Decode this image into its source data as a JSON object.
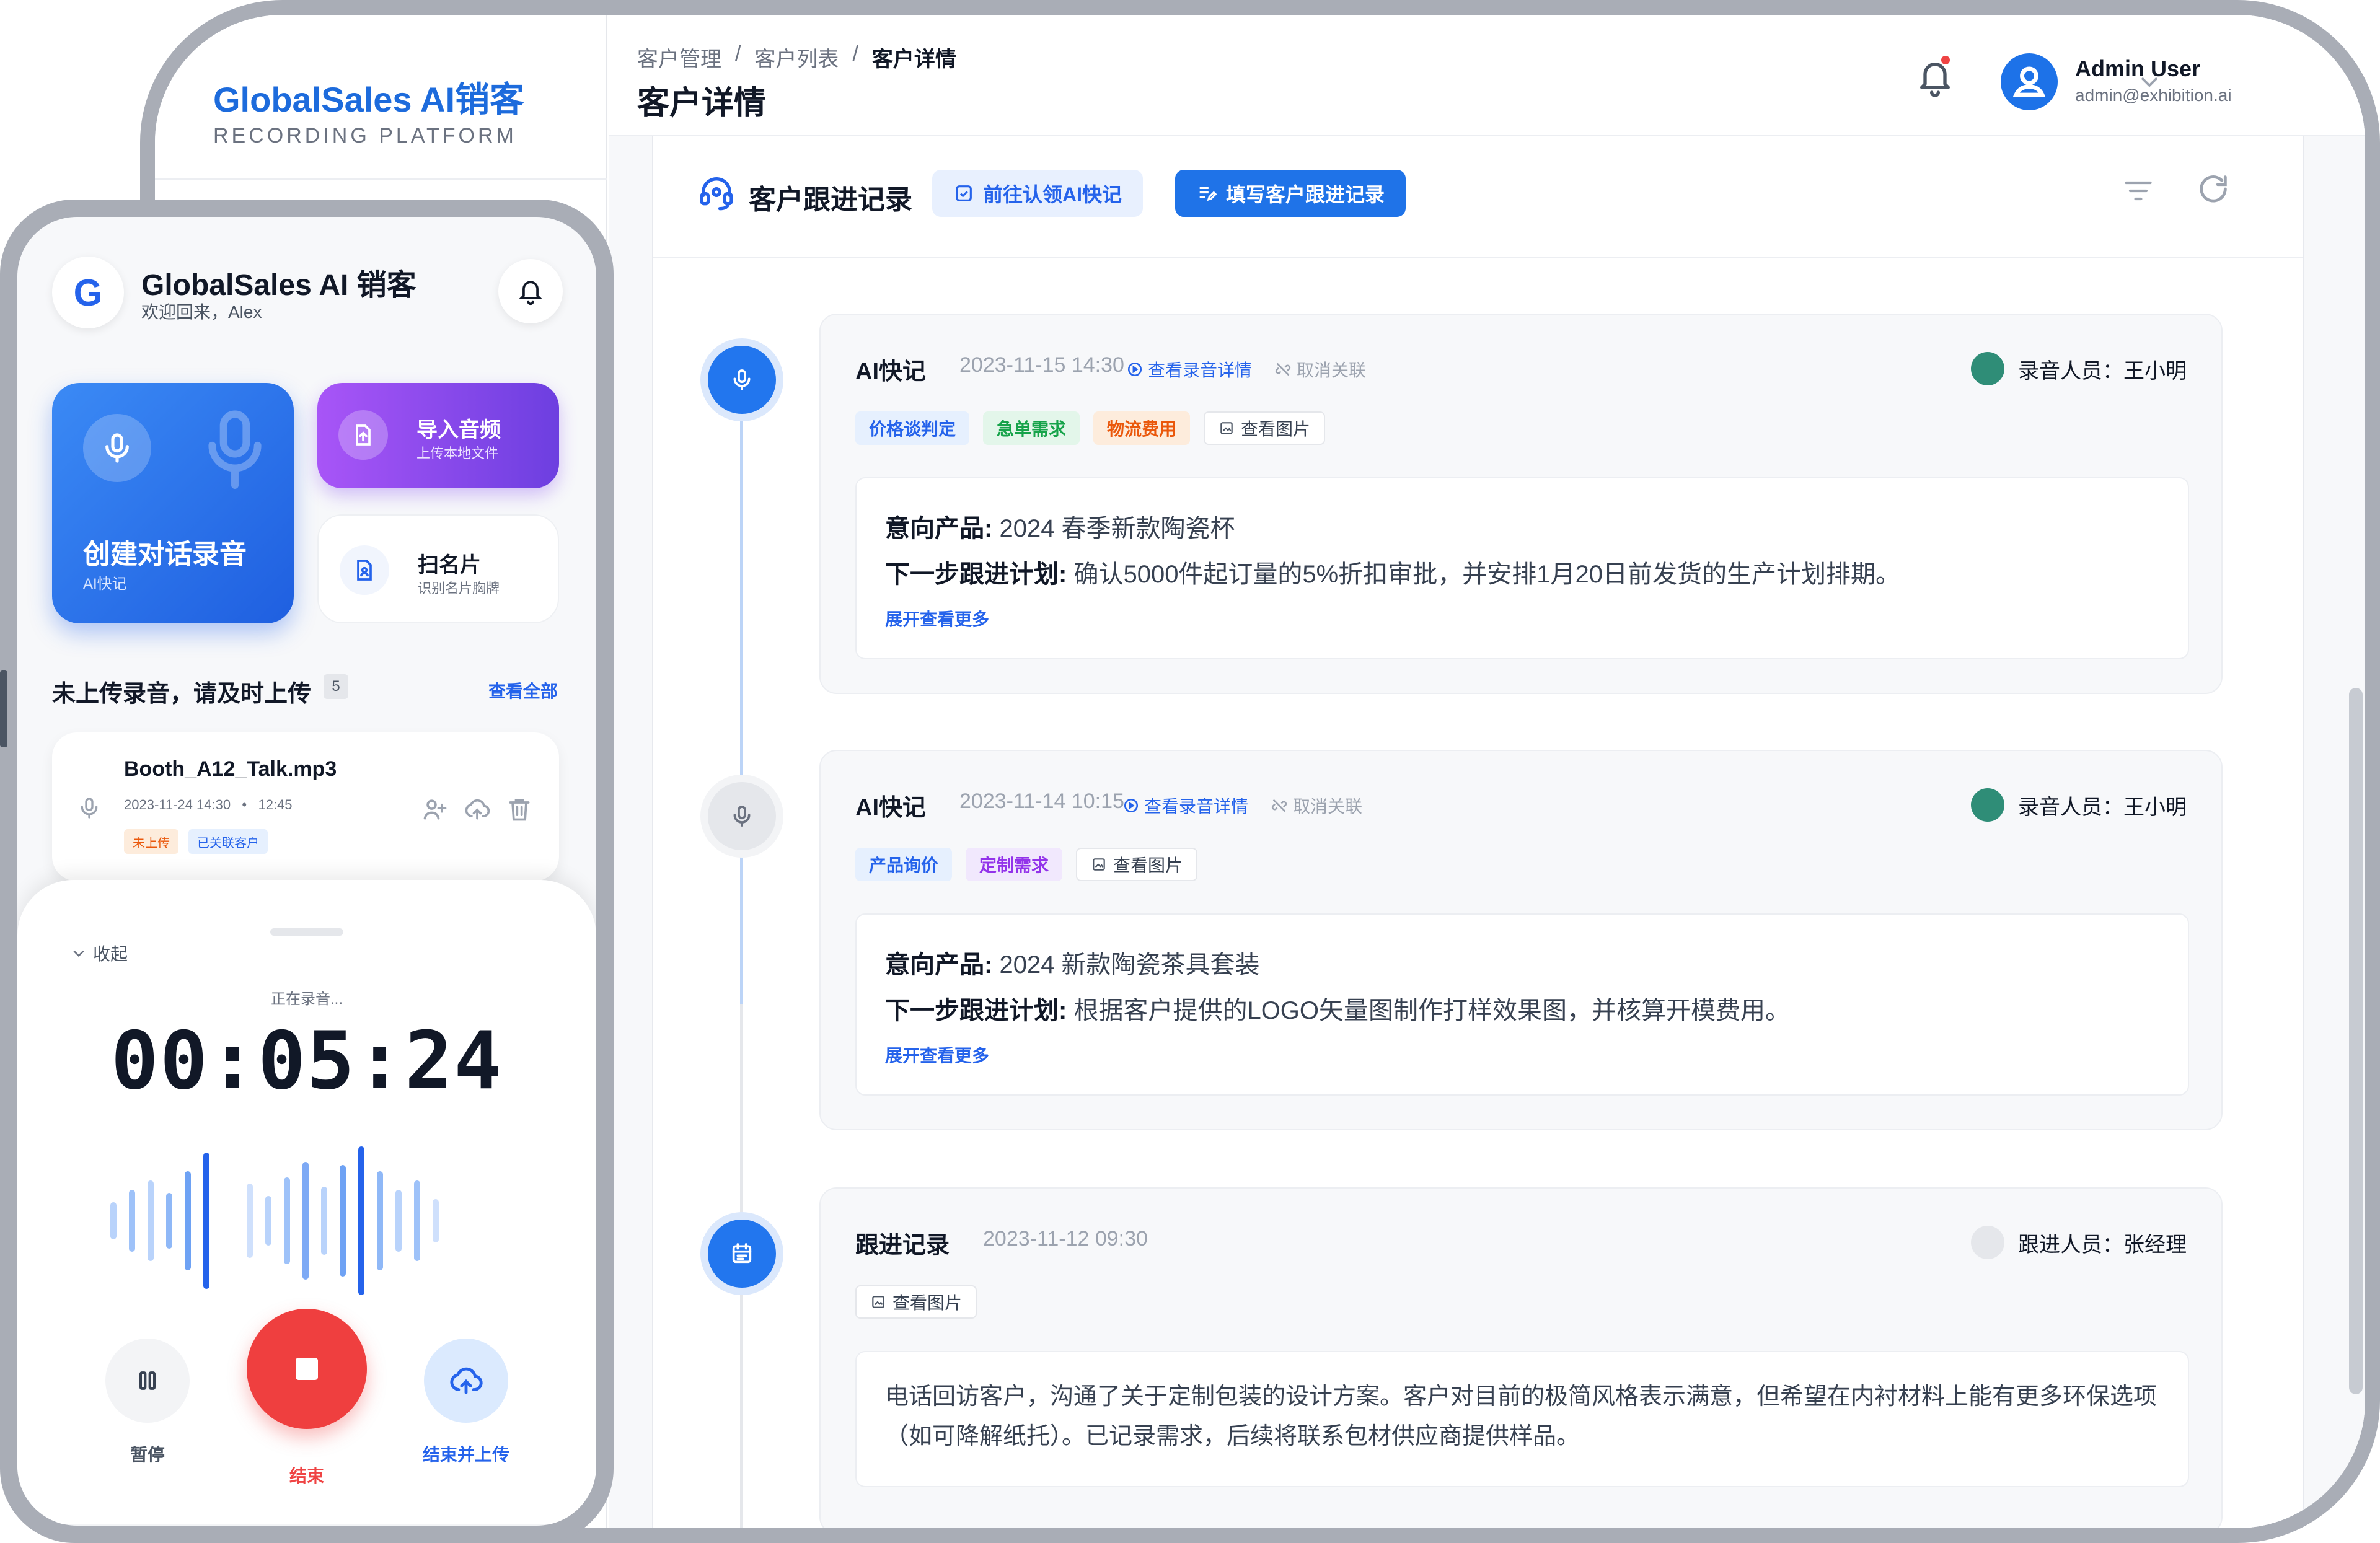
{
  "sidebar": {
    "brand": "GlobalSales AI销客",
    "subtitle": "RECORDING PLATFORM"
  },
  "header": {
    "breadcrumb": [
      "客户管理",
      "客户列表",
      "客户详情"
    ],
    "separator": "/",
    "title": "客户详情",
    "user": {
      "name": "Admin User",
      "email": "admin@exhibition.ai"
    }
  },
  "followup": {
    "title": "客户跟进记录",
    "claim_button": "前往认领AI快记",
    "write_button": "填写客户跟进记录",
    "view_recording": "查看录音详情",
    "unlink": "取消关联",
    "view_image": "查看图片",
    "expand": "展开查看更多",
    "entries": [
      {
        "type": "AI快记",
        "time": "2023-11-15 14:30",
        "recorder": "录音人员：王小明",
        "tags": [
          "价格谈判定",
          "急单需求",
          "物流费用"
        ],
        "product_label": "意向产品:",
        "product": "2024 春季新款陶瓷杯",
        "plan_label": "下一步跟进计划:",
        "plan": "确认5000件起订量的5%折扣审批，并安排1月20日前发货的生产计划排期。"
      },
      {
        "type": "AI快记",
        "time": "2023-11-14 10:15",
        "recorder": "录音人员：王小明",
        "tags": [
          "产品询价",
          "定制需求"
        ],
        "product_label": "意向产品:",
        "product": "2024 新款陶瓷茶具套装",
        "plan_label": "下一步跟进计划:",
        "plan": "根据客户提供的LOGO矢量图制作打样效果图，并核算开模费用。"
      },
      {
        "type": "跟进记录",
        "time": "2023-11-12 09:30",
        "recorder": "跟进人员：张经理",
        "content": "电话回访客户，沟通了关于定制包装的设计方案。客户对目前的极简风格表示满意，但希望在内衬材料上能有更多环保选项（如可降解纸托）。已记录需求，后续将联系包材供应商提供样品。"
      }
    ]
  },
  "phone": {
    "app_logo": "G",
    "app_title": "GlobalSales AI 销客",
    "welcome": "欢迎回来，Alex",
    "record_tile": {
      "title": "创建对话录音",
      "subtitle": "AI快记"
    },
    "import_tile": {
      "title": "导入音频",
      "subtitle": "上传本地文件"
    },
    "scan_tile": {
      "title": "扫名片",
      "subtitle": "识别名片胸牌"
    },
    "pending": {
      "title": "未上传录音，请及时上传",
      "count": "5",
      "view_all": "查看全部"
    },
    "file": {
      "name": "Booth_A12_Talk.mp3",
      "date": "2023-11-24 14:30",
      "dot": "•",
      "duration": "12:45",
      "tags": [
        "未上传",
        "已关联客户"
      ]
    },
    "sheet": {
      "collapse": "收起",
      "status": "正在录音...",
      "timer": "00:05:24",
      "pause": "暂停",
      "stop": "结束",
      "finish": "结束并上传"
    }
  },
  "colors": {
    "accent": "#2563eb",
    "stop": "#ef4444",
    "purple": "#7c3aed"
  }
}
